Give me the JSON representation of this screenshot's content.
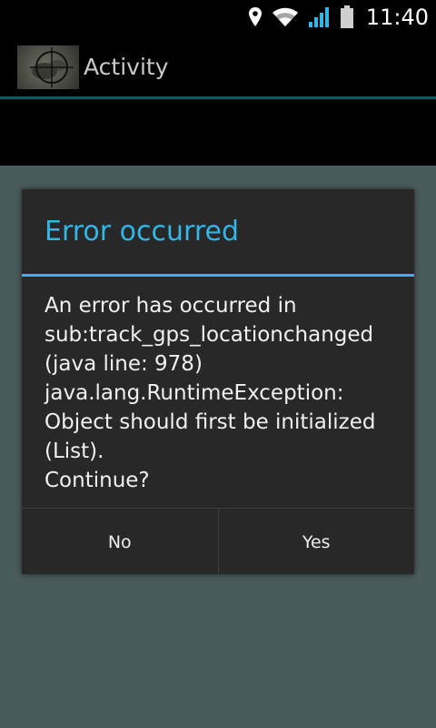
{
  "status_bar": {
    "time": "11:40",
    "icons": [
      "location-pin-icon",
      "wifi-icon",
      "signal-icon",
      "battery-icon"
    ]
  },
  "action_bar": {
    "title": "Activity",
    "icon": "app-icon"
  },
  "dialog": {
    "title": "Error occurred",
    "message": "An error has occurred in\nsub:track_gps_locationchanged\n(java line: 978)\njava.lang.RuntimeException:\nObject should first be initialized\n(List).\nContinue?",
    "buttons": {
      "no": "No",
      "yes": "Yes"
    }
  },
  "colors": {
    "accent": "#33b5e5",
    "dialog_bg": "#282828",
    "screen_bg": "#4a5b5c"
  }
}
